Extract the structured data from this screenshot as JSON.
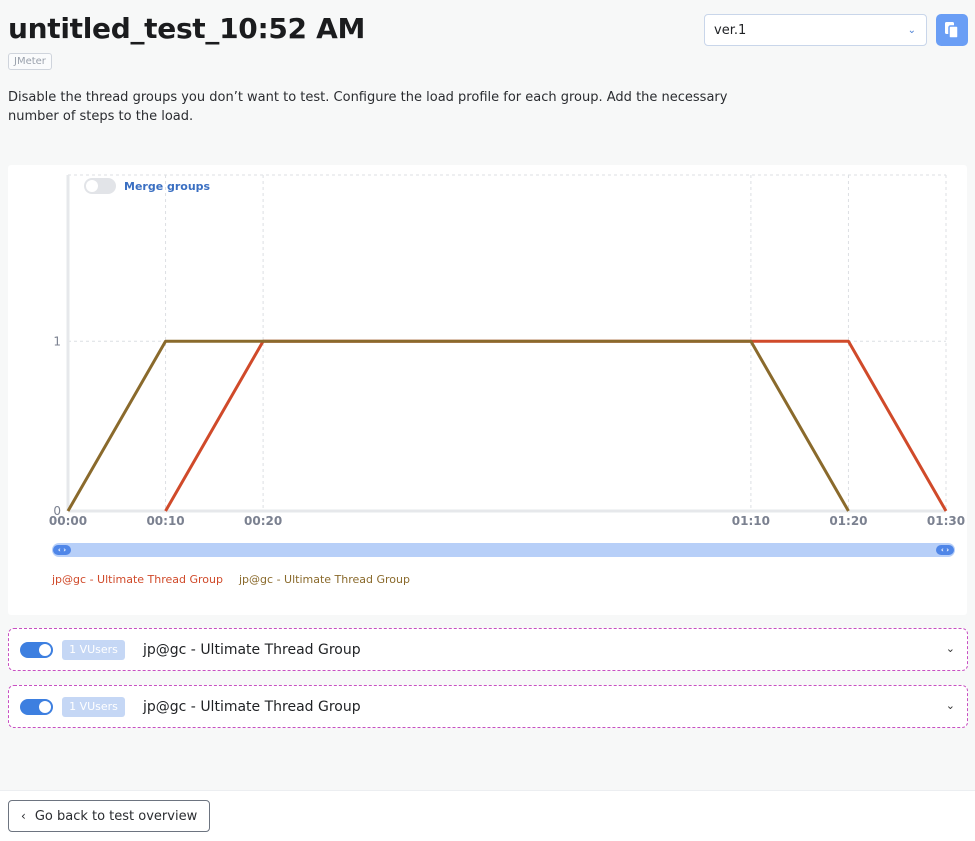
{
  "header": {
    "title": "untitled_test_10:52 AM",
    "tag": "JMeter",
    "description": "Disable the thread groups you don’t want to test. Configure the load profile for each group. Add the necessary number of steps to the load."
  },
  "version_select": {
    "value": "ver.1"
  },
  "merge_groups": {
    "label": "Merge groups",
    "enabled": false
  },
  "chart_data": {
    "type": "line",
    "title": "",
    "xlabel": "",
    "ylabel": "",
    "x_ticks": [
      "00:00",
      "00:10",
      "00:20",
      "01:10",
      "01:20",
      "01:30"
    ],
    "y_ticks": [
      0,
      1
    ],
    "xlim": [
      0,
      90
    ],
    "ylim": [
      0,
      1.98
    ],
    "grid": true,
    "legend_position": "bottom-left",
    "series": [
      {
        "name": "jp@gc - Ultimate Thread Group",
        "color": "#d04a2a",
        "points": [
          [
            10,
            0
          ],
          [
            20,
            1
          ],
          [
            80,
            1
          ],
          [
            90,
            0
          ]
        ]
      },
      {
        "name": "jp@gc - Ultimate Thread Group",
        "color": "#8a6a2c",
        "points": [
          [
            0,
            0
          ],
          [
            10,
            1
          ],
          [
            70,
            1
          ],
          [
            80,
            0
          ]
        ]
      }
    ]
  },
  "thread_groups": [
    {
      "enabled": true,
      "vusers": "1 VUsers",
      "name": "jp@gc - Ultimate Thread Group"
    },
    {
      "enabled": true,
      "vusers": "1 VUsers",
      "name": "jp@gc - Ultimate Thread Group"
    }
  ],
  "footer": {
    "back_label": "Go back to test overview"
  }
}
